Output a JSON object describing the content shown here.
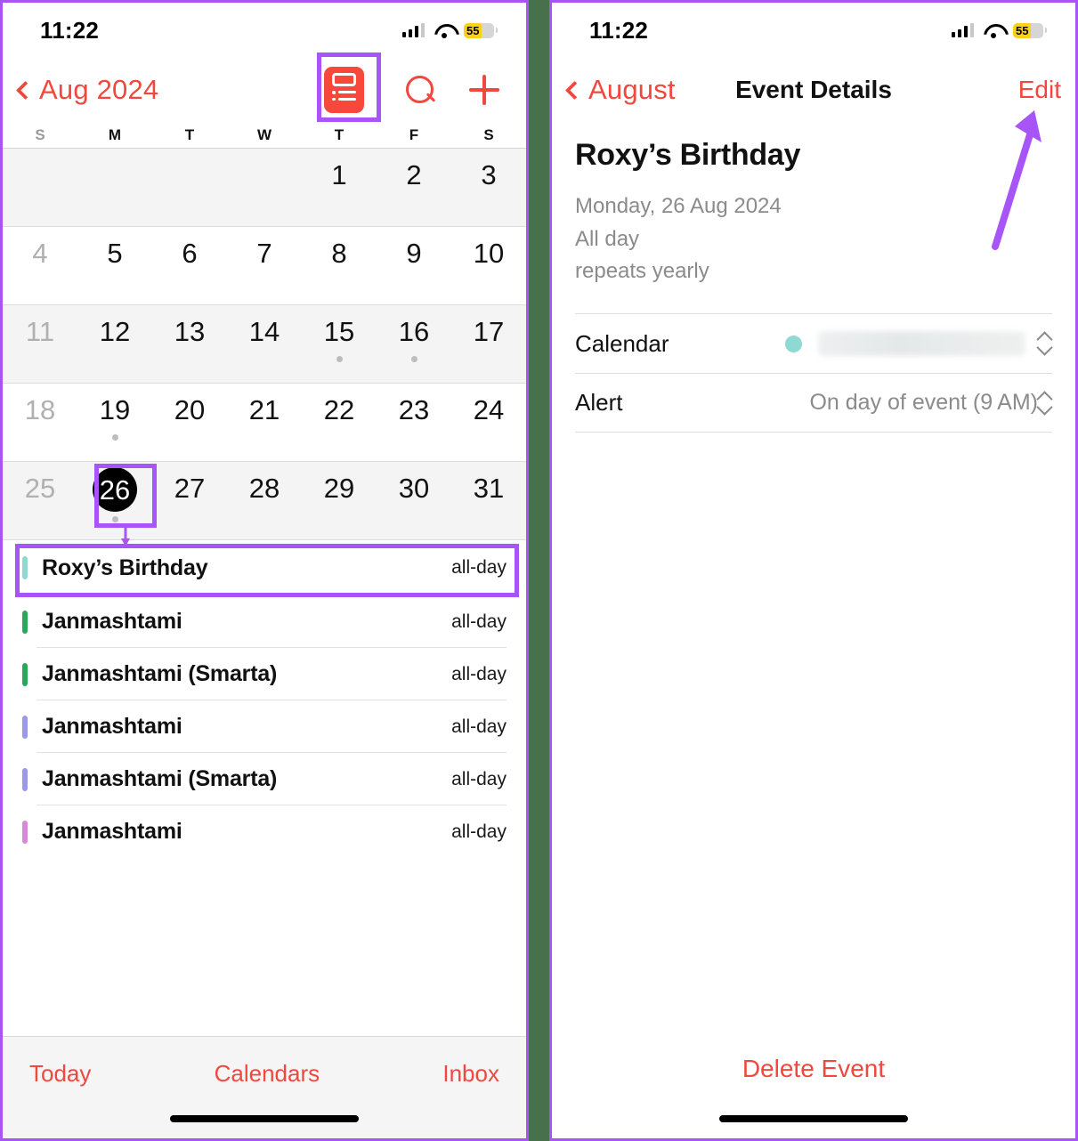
{
  "status_bar": {
    "time": "11:22",
    "battery_percent": "55",
    "icons": [
      "cellular-signal-icon",
      "wifi-icon",
      "battery-icon"
    ]
  },
  "colors": {
    "accent_red": "#f0483e",
    "annotation_purple": "#a855f7",
    "background_green": "#47704b",
    "selected_day": "#000000",
    "calendar_dot_teal": "#8fd8d4"
  },
  "left_panel": {
    "nav": {
      "back_label": "Aug 2024",
      "back_icon": "chevron-left-icon",
      "list_view_icon": "list-view-icon",
      "search_icon": "search-icon",
      "add_icon": "plus-icon"
    },
    "weekdays": [
      {
        "label": "S",
        "dim": true
      },
      {
        "label": "M",
        "dim": false
      },
      {
        "label": "T",
        "dim": false
      },
      {
        "label": "W",
        "dim": false
      },
      {
        "label": "T",
        "dim": false
      },
      {
        "label": "F",
        "dim": false
      },
      {
        "label": "S",
        "dim": false
      }
    ],
    "month_grid": [
      [
        {
          "n": "",
          "dim": true,
          "dot": false,
          "today": false
        },
        {
          "n": "",
          "dim": false,
          "dot": false,
          "today": false
        },
        {
          "n": "",
          "dim": false,
          "dot": false,
          "today": false
        },
        {
          "n": "",
          "dim": false,
          "dot": false,
          "today": false
        },
        {
          "n": "1",
          "dim": false,
          "dot": false,
          "today": false
        },
        {
          "n": "2",
          "dim": false,
          "dot": false,
          "today": false
        },
        {
          "n": "3",
          "dim": false,
          "dot": false,
          "today": false
        }
      ],
      [
        {
          "n": "4",
          "dim": true,
          "dot": false,
          "today": false
        },
        {
          "n": "5",
          "dim": false,
          "dot": false,
          "today": false
        },
        {
          "n": "6",
          "dim": false,
          "dot": false,
          "today": false
        },
        {
          "n": "7",
          "dim": false,
          "dot": false,
          "today": false
        },
        {
          "n": "8",
          "dim": false,
          "dot": false,
          "today": false
        },
        {
          "n": "9",
          "dim": false,
          "dot": false,
          "today": false
        },
        {
          "n": "10",
          "dim": false,
          "dot": false,
          "today": false
        }
      ],
      [
        {
          "n": "11",
          "dim": true,
          "dot": false,
          "today": false
        },
        {
          "n": "12",
          "dim": false,
          "dot": false,
          "today": false
        },
        {
          "n": "13",
          "dim": false,
          "dot": false,
          "today": false
        },
        {
          "n": "14",
          "dim": false,
          "dot": false,
          "today": false
        },
        {
          "n": "15",
          "dim": false,
          "dot": true,
          "today": false
        },
        {
          "n": "16",
          "dim": false,
          "dot": true,
          "today": false
        },
        {
          "n": "17",
          "dim": false,
          "dot": false,
          "today": false
        }
      ],
      [
        {
          "n": "18",
          "dim": true,
          "dot": false,
          "today": false
        },
        {
          "n": "19",
          "dim": false,
          "dot": true,
          "today": false
        },
        {
          "n": "20",
          "dim": false,
          "dot": false,
          "today": false
        },
        {
          "n": "21",
          "dim": false,
          "dot": false,
          "today": false
        },
        {
          "n": "22",
          "dim": false,
          "dot": false,
          "today": false
        },
        {
          "n": "23",
          "dim": false,
          "dot": false,
          "today": false
        },
        {
          "n": "24",
          "dim": false,
          "dot": false,
          "today": false
        }
      ],
      [
        {
          "n": "25",
          "dim": true,
          "dot": false,
          "today": false
        },
        {
          "n": "26",
          "dim": false,
          "dot": true,
          "today": true
        },
        {
          "n": "27",
          "dim": false,
          "dot": false,
          "today": false
        },
        {
          "n": "28",
          "dim": false,
          "dot": false,
          "today": false
        },
        {
          "n": "29",
          "dim": false,
          "dot": false,
          "today": false
        },
        {
          "n": "30",
          "dim": false,
          "dot": false,
          "today": false
        },
        {
          "n": "31",
          "dim": false,
          "dot": false,
          "today": false
        }
      ]
    ],
    "events": [
      {
        "title": "Roxy’s Birthday",
        "when": "all-day",
        "color": "#8fd8d4",
        "highlighted": true
      },
      {
        "title": "Janmashtami",
        "when": "all-day",
        "color": "#2aa85a",
        "highlighted": false
      },
      {
        "title": "Janmashtami (Smarta)",
        "when": "all-day",
        "color": "#2aa85a",
        "highlighted": false
      },
      {
        "title": "Janmashtami",
        "when": "all-day",
        "color": "#9a9ae8",
        "highlighted": false
      },
      {
        "title": "Janmashtami (Smarta)",
        "when": "all-day",
        "color": "#9a9ae8",
        "highlighted": false
      },
      {
        "title": "Janmashtami",
        "when": "all-day",
        "color": "#d988d9",
        "highlighted": false
      }
    ],
    "tabbar": {
      "today_label": "Today",
      "calendars_label": "Calendars",
      "inbox_label": "Inbox"
    }
  },
  "right_panel": {
    "nav": {
      "back_label": "August",
      "back_icon": "chevron-left-icon",
      "title": "Event Details",
      "edit_label": "Edit"
    },
    "event": {
      "title": "Roxy’s Birthday",
      "date": "Monday, 26 Aug 2024",
      "duration": "All day",
      "repeat": "repeats yearly"
    },
    "rows": [
      {
        "label": "Calendar",
        "value": "",
        "redacted": true,
        "has_dot": true,
        "stepper": true
      },
      {
        "label": "Alert",
        "value": "On day of event (9 AM)",
        "redacted": false,
        "has_dot": false,
        "stepper": true
      }
    ],
    "delete_label": "Delete Event"
  }
}
